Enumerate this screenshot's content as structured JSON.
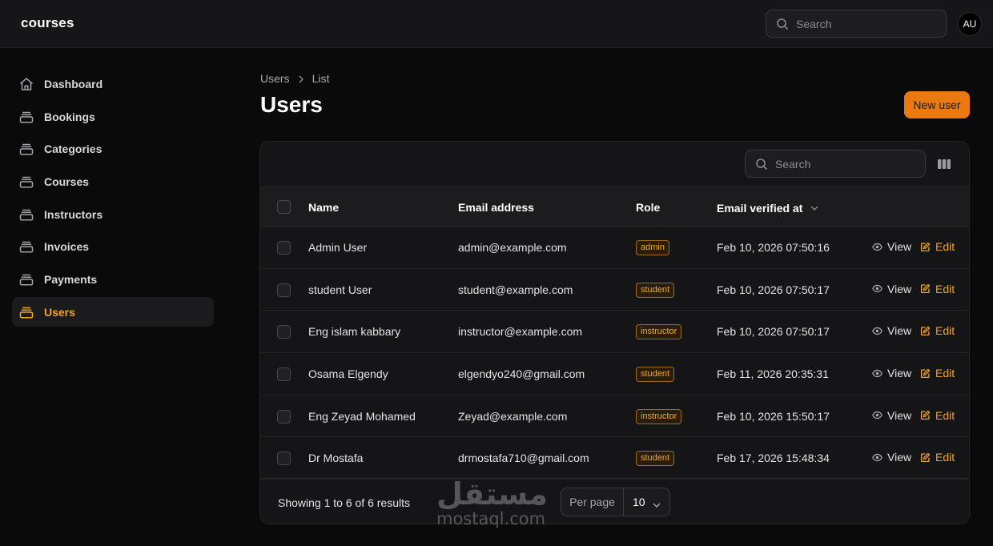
{
  "app": {
    "brand": "courses",
    "avatar_initials": "AU"
  },
  "topbar": {
    "search_placeholder": "Search"
  },
  "sidebar": {
    "items": [
      {
        "label": "Dashboard",
        "icon": "home-icon",
        "active": false
      },
      {
        "label": "Bookings",
        "icon": "stack-icon",
        "active": false
      },
      {
        "label": "Categories",
        "icon": "stack-icon",
        "active": false
      },
      {
        "label": "Courses",
        "icon": "stack-icon",
        "active": false
      },
      {
        "label": "Instructors",
        "icon": "stack-icon",
        "active": false
      },
      {
        "label": "Invoices",
        "icon": "stack-icon",
        "active": false
      },
      {
        "label": "Payments",
        "icon": "stack-icon",
        "active": false
      },
      {
        "label": "Users",
        "icon": "stack-icon",
        "active": true
      }
    ]
  },
  "breadcrumb": {
    "parent": "Users",
    "current": "List"
  },
  "page": {
    "title": "Users",
    "new_button": "New user"
  },
  "table": {
    "search_placeholder": "Search",
    "columns": {
      "name": "Name",
      "email": "Email address",
      "role": "Role",
      "verified": "Email verified at"
    },
    "rows": [
      {
        "name": "Admin User",
        "email": "admin@example.com",
        "role": "admin",
        "verified": "Feb 10, 2026 07:50:16"
      },
      {
        "name": "student User",
        "email": "student@example.com",
        "role": "student",
        "verified": "Feb 10, 2026 07:50:17"
      },
      {
        "name": "Eng islam kabbary",
        "email": "instructor@example.com",
        "role": "instructor",
        "verified": "Feb 10, 2026 07:50:17"
      },
      {
        "name": "Osama Elgendy",
        "email": "elgendyo240@gmail.com",
        "role": "student",
        "verified": "Feb 11, 2026 20:35:31"
      },
      {
        "name": "Eng Zeyad Mohamed",
        "email": "Zeyad@example.com",
        "role": "instructor",
        "verified": "Feb 10, 2026 15:50:17"
      },
      {
        "name": "Dr Mostafa",
        "email": "drmostafa710@gmail.com",
        "role": "student",
        "verified": "Feb 17, 2026 15:48:34"
      }
    ],
    "actions": {
      "view": "View",
      "edit": "Edit"
    }
  },
  "footer": {
    "showing": "Showing 1 to 6 of 6 results",
    "per_page_label": "Per page",
    "per_page_value": "10"
  },
  "watermark": {
    "arabic": "مستقل",
    "latin": "mostaql.com"
  },
  "colors": {
    "accent": "#f5a524",
    "primary_button": "#ea7a0f",
    "background": "#0a0a0b"
  }
}
